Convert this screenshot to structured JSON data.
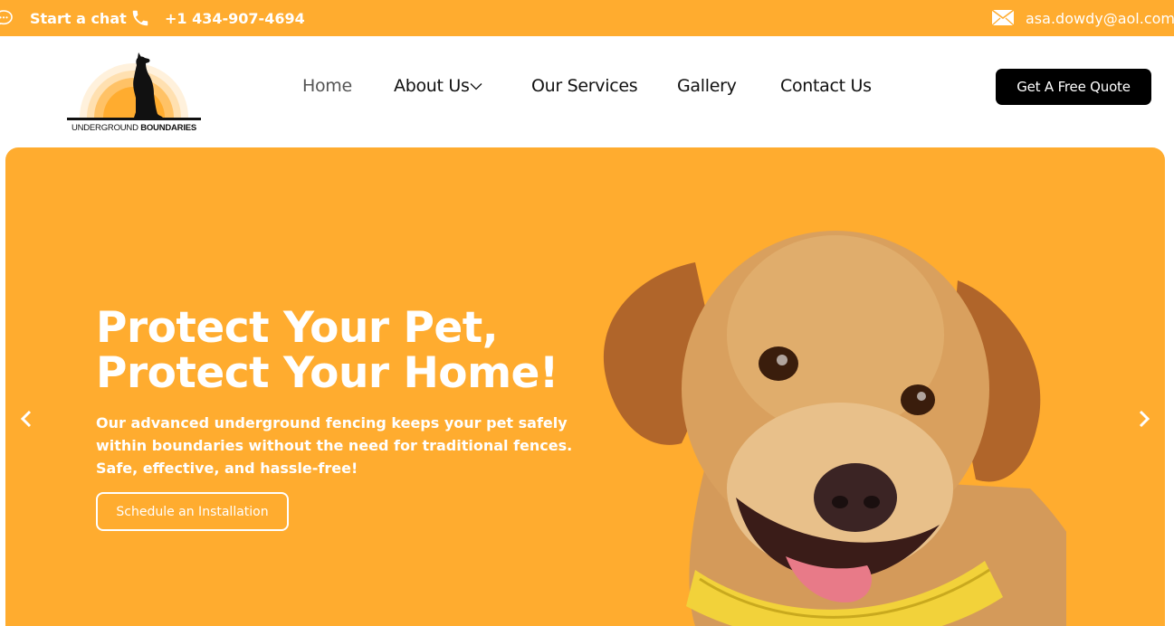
{
  "topbar": {
    "chat_label": "Start a chat",
    "chat_icon": "chat-bubble-icon",
    "phone_icon": "phone-icon",
    "phone": "+1 434-907-4694",
    "mail_icon": "envelope-icon",
    "email": "asa.dowdy@aol.com"
  },
  "logo": {
    "text_regular": "UNDERGROUND ",
    "text_bold": "BOUNDARIES"
  },
  "nav": {
    "items": [
      {
        "label": "Home",
        "active": true
      },
      {
        "label": "About Us",
        "has_dropdown": true
      },
      {
        "label": "Our Services"
      },
      {
        "label": "Gallery"
      },
      {
        "label": "Contact Us"
      }
    ]
  },
  "header": {
    "quote_button": "Get A Free Quote"
  },
  "hero": {
    "title_line1": "Protect Your Pet,",
    "title_line2": "Protect Your Home!",
    "description": "Our advanced underground fencing keeps your pet safely within boundaries without the need for traditional fences. Safe, effective, and hassle-free!",
    "cta": "Schedule an Installation",
    "prev_icon": "chevron-left-icon",
    "next_icon": "chevron-right-icon"
  },
  "colors": {
    "brand_orange": "#ffac2f",
    "button_black": "#000000",
    "text_white": "#ffffff"
  }
}
